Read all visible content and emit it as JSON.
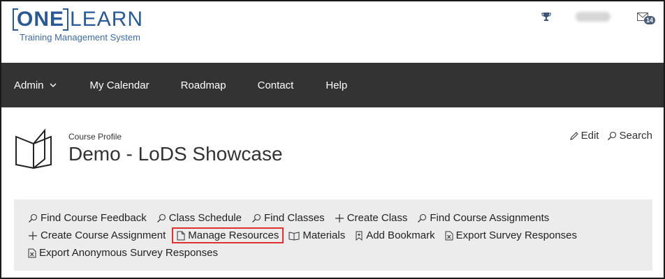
{
  "logo": {
    "one": "ONE",
    "learn": "LEARN",
    "subtitle": "Training Management System"
  },
  "header": {
    "mail_count": "14",
    "trophy_icon": "trophy-icon",
    "mail_icon": "mail-icon"
  },
  "nav": {
    "items": [
      {
        "label": "Admin",
        "has_dropdown": true
      },
      {
        "label": "My Calendar"
      },
      {
        "label": "Roadmap"
      },
      {
        "label": "Contact"
      },
      {
        "label": "Help"
      }
    ]
  },
  "course": {
    "breadcrumb": "Course Profile",
    "title": "Demo - LoDS Showcase",
    "edit_label": "Edit",
    "search_label": "Search"
  },
  "toolbar": {
    "find_course_feedback": "Find Course Feedback",
    "class_schedule": "Class Schedule",
    "find_classes": "Find Classes",
    "create_class": "Create Class",
    "find_course_assignments": "Find Course Assignments",
    "create_course_assignment": "Create Course Assignment",
    "manage_resources": "Manage Resources",
    "materials": "Materials",
    "add_bookmark": "Add Bookmark",
    "export_survey_responses": "Export Survey Responses",
    "export_anonymous_survey_responses": "Export Anonymous Survey Responses"
  },
  "colors": {
    "brand": "#2a5a96",
    "navbar": "#333333",
    "panel": "#ececec",
    "highlight": "#e03030",
    "badge": "#4a5d78"
  }
}
